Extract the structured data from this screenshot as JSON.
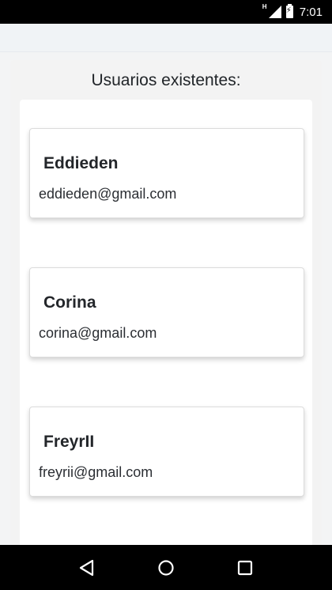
{
  "status_bar": {
    "network": "H",
    "time": "7:01"
  },
  "panel": {
    "title": "Usuarios existentes:"
  },
  "users": [
    {
      "name": "Eddieden",
      "email": "eddieden@gmail.com"
    },
    {
      "name": "Corina",
      "email": "corina@gmail.com"
    },
    {
      "name": "FreyrII",
      "email": "freyrii@gmail.com"
    }
  ],
  "nav_bar": {
    "icons": [
      "back-icon",
      "home-icon",
      "recents-icon"
    ]
  }
}
